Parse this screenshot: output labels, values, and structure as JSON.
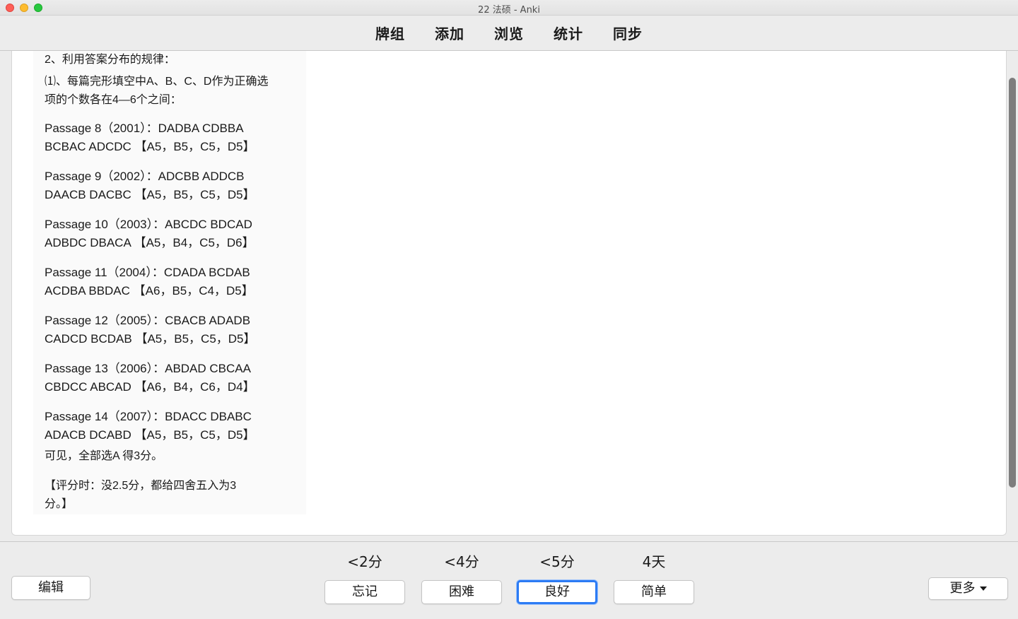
{
  "window": {
    "title": "22 法硕 - Anki"
  },
  "nav": {
    "decks": "牌组",
    "add": "添加",
    "browse": "浏览",
    "stats": "统计",
    "sync": "同步"
  },
  "card": {
    "heading": "2、利用答案分布的规律：",
    "sub_line1": "⑴、每篇完形填空中A、B、C、D作为正确选",
    "sub_line2": "项的个数各在4—6个之间：",
    "passages": [
      {
        "line1": "Passage 8（2001）：DADBA CDBBA",
        "line2": "BCBAC ADCDC 【A5，B5，C5，D5】"
      },
      {
        "line1": "Passage 9（2002）：ADCBB ADDCB",
        "line2": "DAACB DACBC 【A5，B5，C5，D5】"
      },
      {
        "line1": "Passage 10（2003）：ABCDC BDCAD",
        "line2": "ADBDC DBACA 【A5，B4，C5，D6】"
      },
      {
        "line1": "Passage 11（2004）：CDADA BCDAB",
        "line2": "ACDBA BBDAC 【A6，B5，C4，D5】"
      },
      {
        "line1": "Passage 12（2005）：CBACB ADADB",
        "line2": "CADCD BCDAB 【A5，B5，C5，D5】"
      },
      {
        "line1": "Passage 13（2006）：ABDAD CBCAA",
        "line2": "CBDCC ABCAD 【A6，B4，C6，D4】"
      },
      {
        "line1": "Passage 14（2007）：BDACC DBABC",
        "line2": "ADACB DCABD 【A5，B5，C5，D5】"
      }
    ],
    "conclusion": "可见，全部选A 得3分。",
    "scoring_line1": "【评分时：没2.5分，都给四舍五入为3",
    "scoring_line2": "分。】"
  },
  "bottom": {
    "edit": "编辑",
    "more": "更多",
    "answers": [
      {
        "time": "<2分",
        "label": "忘记"
      },
      {
        "time": "<4分",
        "label": "困难"
      },
      {
        "time": "<5分",
        "label": "良好"
      },
      {
        "time": "4天",
        "label": "简单"
      }
    ]
  },
  "colors": {
    "focus_ring": "#2c7bf4",
    "close": "#fe5f57",
    "minimize": "#febc2e",
    "maximize": "#28c840"
  }
}
